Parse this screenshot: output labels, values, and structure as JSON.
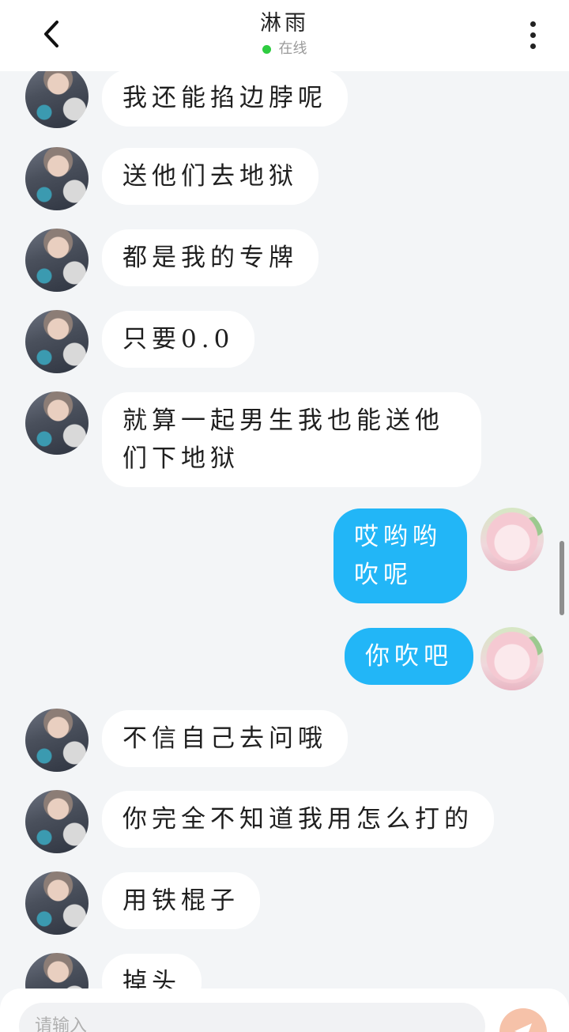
{
  "header": {
    "title": "淋雨",
    "status": "在线",
    "status_color": "#2ecc40"
  },
  "messages": [
    {
      "from": "friend",
      "text": "我还能掐边脖呢"
    },
    {
      "from": "friend",
      "text": "送他们去地狱"
    },
    {
      "from": "friend",
      "text": "都是我的专牌"
    },
    {
      "from": "friend",
      "text": "只要0.0"
    },
    {
      "from": "friend",
      "text": "就算一起男生我也能送他们下地狱"
    },
    {
      "from": "self",
      "text": "哎哟哟吹呢"
    },
    {
      "from": "self",
      "text": "你吹吧"
    },
    {
      "from": "friend",
      "text": "不信自己去问哦"
    },
    {
      "from": "friend",
      "text": "你完全不知道我用怎么打的"
    },
    {
      "from": "friend",
      "text": "用铁棍子"
    },
    {
      "from": "friend",
      "text": "掉头"
    }
  ],
  "input": {
    "placeholder": "请输入"
  },
  "icons": {
    "back": "chevron-left-icon",
    "more": "more-vertical-icon",
    "send": "send-icon"
  },
  "colors": {
    "self_bubble": "#22b6f7",
    "friend_bubble": "#ffffff",
    "background": "#f3f5f7",
    "send_button": "#f6c2a9"
  }
}
